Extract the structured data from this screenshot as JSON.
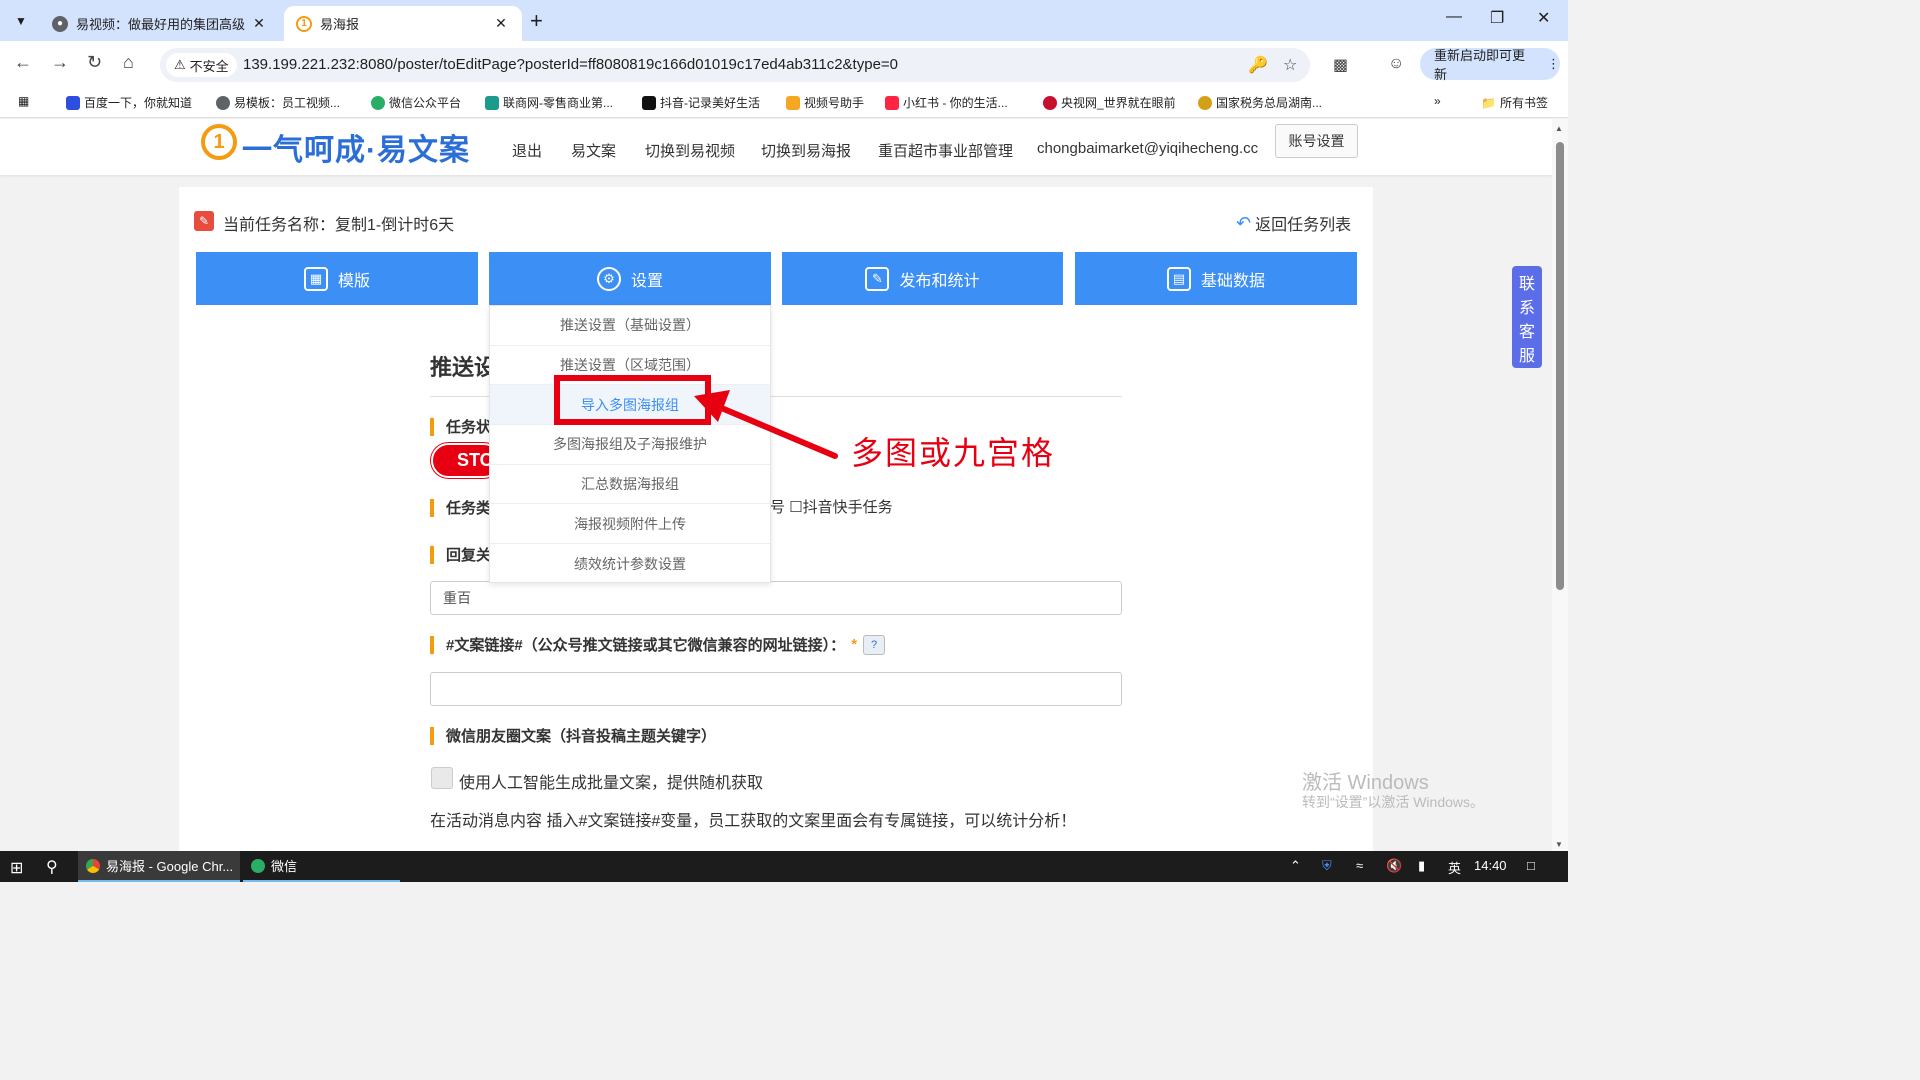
{
  "browser": {
    "tabs": [
      {
        "title": "易视频：做最好用的集团高级",
        "active": false
      },
      {
        "title": "易海报",
        "active": true
      }
    ],
    "url": "139.199.221.232:8080/poster/toEditPage?posterId=ff8080819c166d01019c17ed4ab311c2&type=0",
    "insecure_label": "不安全",
    "update_label": "重新启动即可更新",
    "bookmarks": [
      "百度一下，你就知道",
      "易模板：员工视频...",
      "微信公众平台",
      "联商网-零售商业第...",
      "抖音-记录美好生活",
      "视频号助手",
      "小红书 - 你的生活...",
      "央视网_世界就在眼前",
      "国家税务总局湖南..."
    ],
    "all_bookmarks": "所有书签"
  },
  "header": {
    "logo_mark": "1",
    "logo_text": "一气呵成·易文案",
    "nav": [
      "退出",
      "易文案",
      "切换到易视频",
      "切换到易海报",
      "重百超市事业部管理",
      "chongbaimarket@yiqihecheng.cc"
    ],
    "account_button": "账号设置"
  },
  "task": {
    "current_task": "当前任务名称：复制1-倒计时6天",
    "back_link": "返回任务列表"
  },
  "main_tabs": [
    {
      "label": "模版",
      "icon": "template-icon"
    },
    {
      "label": "设置",
      "icon": "gear-icon"
    },
    {
      "label": "发布和统计",
      "icon": "edit-icon"
    },
    {
      "label": "基础数据",
      "icon": "data-icon"
    }
  ],
  "dropdown": {
    "items": [
      "推送设置（基础设置）",
      "推送设置（区域范围）",
      "导入多图海报组",
      "多图海报组及子海报维护",
      "汇总数据海报组",
      "海报视频附件上传",
      "绩效统计参数设置"
    ],
    "active_index": 2
  },
  "annotation": {
    "text": "多图或九宫格",
    "color": "#e60012"
  },
  "form": {
    "section_title": "推送设",
    "task_status_label": "任务状",
    "stop_button": "STO",
    "task_type_label": "任务类",
    "task_type_checkbox": "号 ☐抖音快手任务",
    "reply_label": "回复关",
    "reply_value": "重百",
    "link_label": "#文案链接#（公众号推文链接或其它微信兼容的网址链接）：",
    "link_required": "*",
    "link_help": "?",
    "link_value": "",
    "moments_label": "微信朋友圈文案（抖音投稿主题关键字）",
    "ai_checkbox_label": "使用人工智能生成批量文案，提供随机获取",
    "tip": "在活动消息内容 插入#文案链接#变量，员工获取的文案里面会有专属链接，可以统计分析！"
  },
  "service": [
    "联",
    "系",
    "客",
    "服"
  ],
  "watermark": {
    "line1": "激活 Windows",
    "line2": "转到“设置”以激活 Windows。"
  },
  "taskbar": {
    "apps": [
      "易海报 - Google Chr...",
      "微信"
    ],
    "ime": "英",
    "time": "14:40"
  },
  "colors": {
    "primary": "#3b8ff5",
    "accent": "#f39c12",
    "red": "#e60012"
  }
}
